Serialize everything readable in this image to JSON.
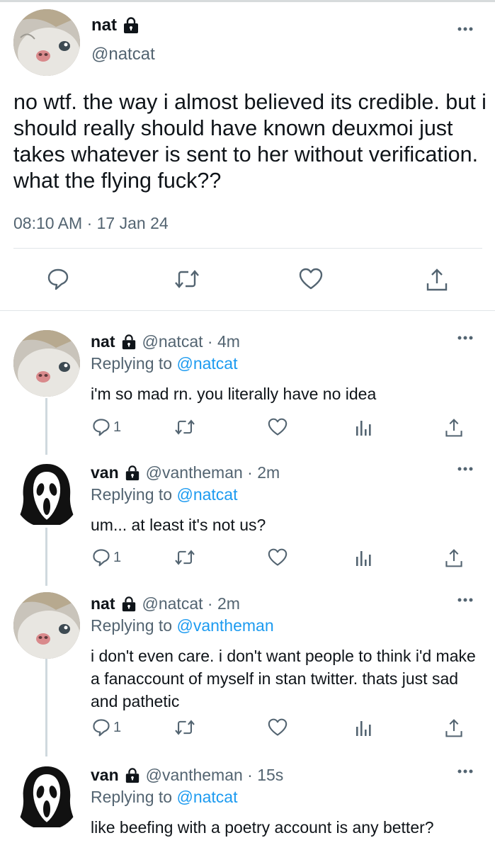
{
  "colors": {
    "text": "#0f1419",
    "secondary": "#536471",
    "link": "#1d9bf0",
    "divider": "#e1e5e8"
  },
  "main_tweet": {
    "display_name": "nat",
    "handle": "@natcat",
    "text": "no wtf. the way i almost believed its credible. but i should really should have known deuxmoi just takes whatever is sent to her without verification. what the flying fuck??",
    "timestamp": "08:10 AM · 17 Jan 24",
    "avatar": "cat-avatar",
    "actions": [
      "reply-icon",
      "retweet-icon",
      "like-icon",
      "share-icon"
    ]
  },
  "replies": [
    {
      "display_name": "nat",
      "handle_time": "@natcat · 4m",
      "replying_prefix": "Replying to ",
      "replying_to": "@natcat",
      "text": "i'm so mad rn. you literally have no idea",
      "reply_count": "1",
      "avatar": "cat-avatar"
    },
    {
      "display_name": "van",
      "handle_time": "@vantheman · 2m",
      "replying_prefix": "Replying to ",
      "replying_to": "@natcat",
      "text": "um... at least it's not us?",
      "reply_count": "1",
      "avatar": "ghostface-avatar"
    },
    {
      "display_name": "nat",
      "handle_time": "@natcat · 2m",
      "replying_prefix": "Replying to ",
      "replying_to": "@vantheman",
      "text": "i don't even care. i don't want people to think i'd make a fanaccount of myself in stan twitter. thats just sad and pathetic",
      "reply_count": "1",
      "avatar": "cat-avatar"
    },
    {
      "display_name": "van",
      "handle_time": "@vantheman · 15s",
      "replying_prefix": "Replying to ",
      "replying_to": "@natcat",
      "text": "like beefing with a poetry account is any better?",
      "avatar": "ghostface-avatar"
    }
  ]
}
